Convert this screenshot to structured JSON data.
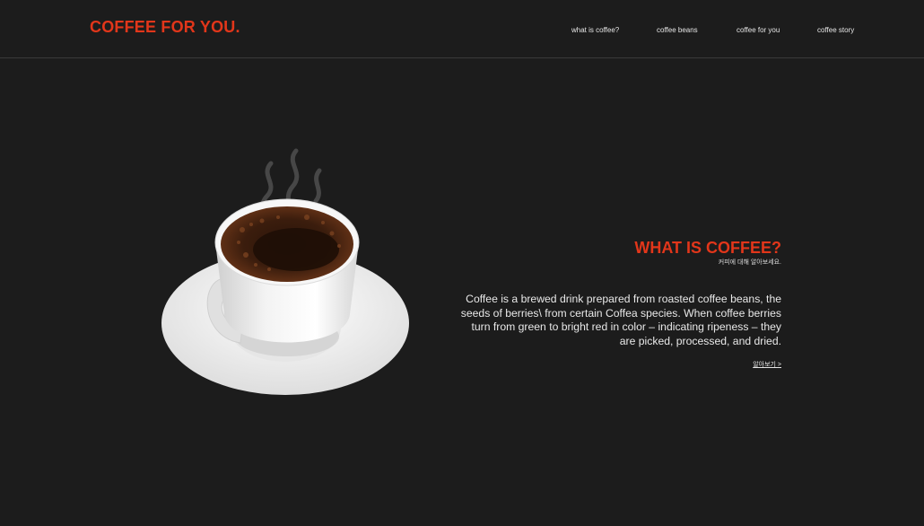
{
  "header": {
    "logo": "COFFEE FOR YOU.",
    "nav": [
      {
        "label": "what is coffee?"
      },
      {
        "label": "coffee beans"
      },
      {
        "label": "coffee for you"
      },
      {
        "label": "coffee story"
      }
    ]
  },
  "hero": {
    "title": "WHAT IS COFFEE?",
    "subtitle": "커피에 대해 알아보세요.",
    "body": "Coffee is a brewed drink prepared from roasted coffee beans, the seeds of berries\\ from certain Coffea species. When coffee berries turn from green to bright red in color – indicating ripeness – they are picked, processed, and dried.",
    "more_link": "알아보기 >",
    "image_icon": "coffee-cup"
  },
  "colors": {
    "accent": "#e2361a",
    "background": "#1c1c1c",
    "text": "#e8e8e8"
  }
}
